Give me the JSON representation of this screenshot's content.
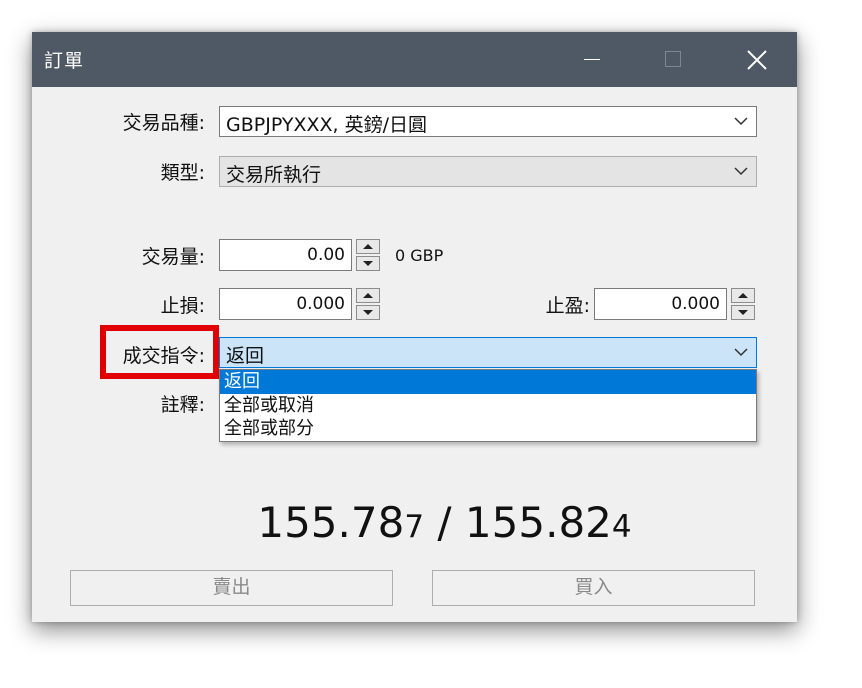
{
  "window": {
    "title": "訂單"
  },
  "form": {
    "symbol_label": "交易品種:",
    "symbol_value": "GBPJPYXXX, 英鎊/日圓",
    "type_label": "類型:",
    "type_value": "交易所執行",
    "volume_label": "交易量:",
    "volume_value": "0.00",
    "volume_unit": "0 GBP",
    "stoploss_label": "止損:",
    "stoploss_value": "0.000",
    "takeprofit_label": "止盈:",
    "takeprofit_value": "0.000",
    "filling_label": "成交指令:",
    "filling_value": "返回",
    "comment_label": "註釋:"
  },
  "filling_dropdown": {
    "options": [
      "返回",
      "全部或取消",
      "全部或部分"
    ],
    "selected_index": 0
  },
  "quote": {
    "bid_main": "155.78",
    "bid_last": "7",
    "separator": " / ",
    "ask_main": "155.82",
    "ask_last": "4"
  },
  "buttons": {
    "sell_label": "賣出",
    "buy_label": "買入"
  },
  "colors": {
    "titlebar": "#4f5965",
    "highlight_box": "#e00000",
    "selection": "#0078d7",
    "active_field": "#cce4f7"
  }
}
